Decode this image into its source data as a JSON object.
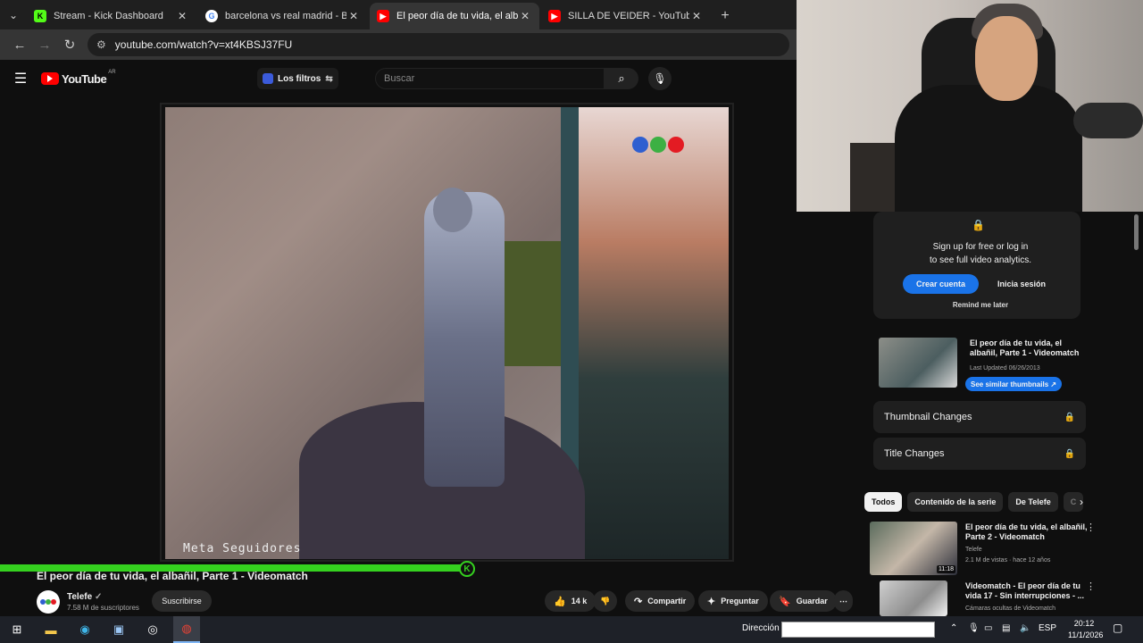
{
  "browser": {
    "tabs": [
      {
        "title": "Stream - Kick Dashboard",
        "favicon": "kick-icon",
        "active": false
      },
      {
        "title": "barcelona vs real madrid - Busc",
        "favicon": "google-icon",
        "active": false
      },
      {
        "title": "El peor día de tu vida, el albañil",
        "favicon": "youtube-icon",
        "active": true
      },
      {
        "title": "SILLA DE VEIDER - YouTube",
        "favicon": "youtube-icon",
        "active": false
      }
    ],
    "url": "youtube.com/watch?v=xt4KBSJ37FU"
  },
  "youtube": {
    "logo_text": "YouTube",
    "region": "AR",
    "filters_label": "Los filtros",
    "search_placeholder": "Buscar"
  },
  "player": {
    "watermark": "Meta Seguidores",
    "progress_fraction": 0.6,
    "dots_colors": [
      "#2f5fd0",
      "#3cb043",
      "#e31b23"
    ]
  },
  "video": {
    "title": "El peor día de tu vida, el albañil, Parte 1 - Videomatch",
    "channel": "Telefe",
    "subscribers": "7.58 M de suscriptores",
    "subscribe_label": "Suscribirse",
    "likes": "14 k",
    "share_label": "Compartir",
    "ask_label": "Preguntar",
    "save_label": "Guardar"
  },
  "analytics": {
    "message_line1": "Sign up for free or log in",
    "message_line2": "to see full video analytics.",
    "create_label": "Crear cuenta",
    "login_label": "Inicia sesión",
    "remind_label": "Remind me later"
  },
  "related_card": {
    "title_line1": "El peor día de tu vida, el",
    "title_line2": "albañil, Parte 1 - Videomatch",
    "updated": "Last Updated 06/26/2013",
    "similar_label": "See similar thumbnails ↗"
  },
  "features": [
    {
      "label": "Thumbnail Changes"
    },
    {
      "label": "Title Changes"
    }
  ],
  "chips": [
    "Todos",
    "Contenido de la serie",
    "De Telefe",
    "C"
  ],
  "up_next": [
    {
      "title_line1": "El peor día de tu vida, el albañil,",
      "title_line2": "Parte 2 - Videomatch",
      "channel": "Telefe",
      "meta": "2.1 M de vistas · hace 12 años",
      "duration": "11:18"
    },
    {
      "title_line1": "Videomatch - El peor día de tu",
      "title_line2": "vida 17 - Sin interrupciones - ...",
      "channel": "Cámaras ocultas de Videomatch",
      "meta": "",
      "duration": ""
    }
  ],
  "taskbar": {
    "address_label": "Dirección",
    "language": "ESP",
    "time": "20:12",
    "date": "11/1/2026"
  }
}
